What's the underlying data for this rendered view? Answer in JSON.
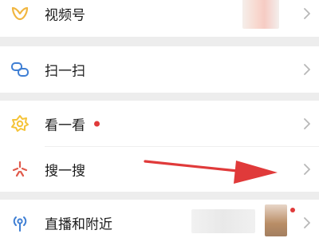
{
  "colors": {
    "background": "#ededed",
    "card": "#ffffff",
    "text": "#1a1a1a",
    "chevron": "#b8b8b8",
    "accent_red": "#e03a3a",
    "channels_icon": "#f1b640",
    "scan_icon": "#3f7fd4",
    "topstories_icon": "#f5c43a",
    "search_icon": "#e15a4b",
    "nearby_icon": "#3f7fd4"
  },
  "menu": {
    "channels": {
      "label": "视频号",
      "icon": "channels-icon"
    },
    "scan": {
      "label": "扫一扫",
      "icon": "scan-icon"
    },
    "top_stories": {
      "label": "看一看",
      "icon": "top-stories-icon",
      "badge": "red-dot"
    },
    "search": {
      "label": "搜一搜",
      "icon": "search-icon"
    },
    "live_nearby": {
      "label": "直播和附近",
      "icon": "live-nearby-icon"
    }
  },
  "annotation": {
    "icon": "red-arrow",
    "points_to": "搜一搜"
  }
}
